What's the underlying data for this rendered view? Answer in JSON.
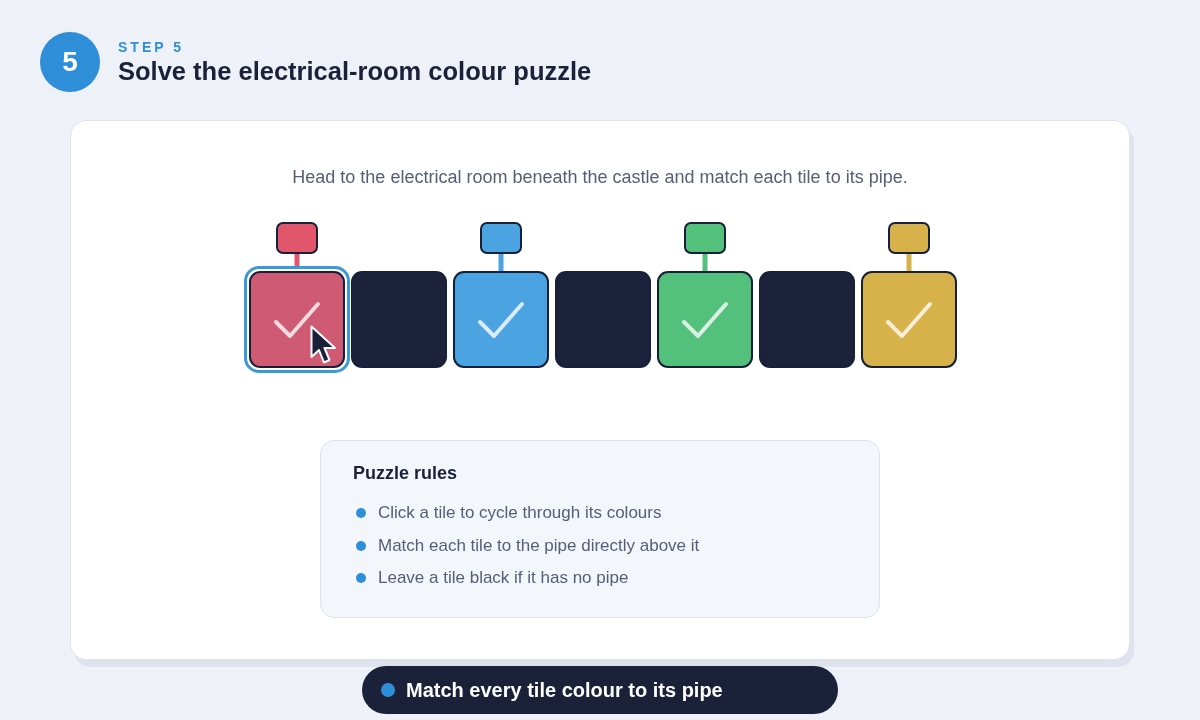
{
  "header": {
    "step_number": "5",
    "step_label": "STEP 5",
    "title": "Solve the electrical-room colour puzzle"
  },
  "puzzle": {
    "instruction": "Head to the electrical room beneath the castle and match each tile to its pipe.",
    "tiles": [
      {
        "color": "#cf5a74",
        "pipe": {
          "color": "#e2566b"
        },
        "checked": true,
        "selected": true,
        "hovered": true
      },
      {
        "color": "#1c2239",
        "checked": false,
        "selected": false,
        "hovered": false
      },
      {
        "color": "#4ba3e1",
        "pipe": {
          "color": "#4ba3e1"
        },
        "checked": true,
        "selected": false,
        "hovered": false
      },
      {
        "color": "#1c2239",
        "checked": false,
        "selected": false,
        "hovered": false
      },
      {
        "color": "#53c17b",
        "pipe": {
          "color": "#53c17b"
        },
        "checked": true,
        "selected": false,
        "hovered": false
      },
      {
        "color": "#1c2239",
        "checked": false,
        "selected": false,
        "hovered": false
      },
      {
        "color": "#d7b24b",
        "pipe": {
          "color": "#d7b24b"
        },
        "checked": true,
        "selected": false,
        "hovered": false
      }
    ]
  },
  "rules": {
    "title": "Puzzle rules",
    "items": [
      "Click a tile to cycle through its colours",
      "Match each tile to the pipe directly above it",
      "Leave a tile black if it has no pipe"
    ]
  },
  "status": {
    "text": "Match every tile colour to its pipe"
  }
}
